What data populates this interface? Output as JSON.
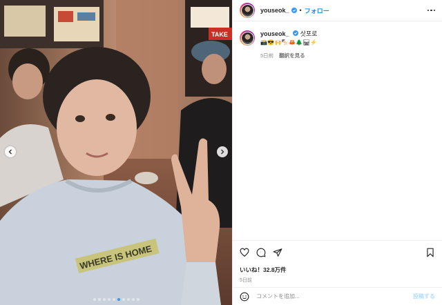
{
  "post": {
    "username": "youseok_",
    "follow_label": "フォロー",
    "separator": "•",
    "caption_text": "삿포로",
    "caption_emojis": "📸😎🙌🍢🦀🌲🛤⚡",
    "time_ago": "5日前",
    "translate_label": "翻訳を見る",
    "likes": "いいね！32.8万件",
    "date": "5日前",
    "comment_placeholder": "コメントを追加...",
    "post_button": "投稿する"
  },
  "photo": {
    "shop_sign": "TAKE",
    "shirt_print": "WHERE IS HOME"
  },
  "carousel": {
    "count": 10,
    "active": 5
  },
  "icons": {
    "verified": "verified-badge-icon",
    "more": "more-options-icon",
    "like": "heart-icon",
    "comment": "comment-icon",
    "share": "share-icon",
    "save": "bookmark-icon",
    "emoji": "smiley-icon",
    "prev": "chevron-left-icon",
    "next": "chevron-right-icon"
  },
  "colors": {
    "accent": "#0095f6",
    "verified": "#3897f0",
    "muted": "#8e8e8e"
  }
}
